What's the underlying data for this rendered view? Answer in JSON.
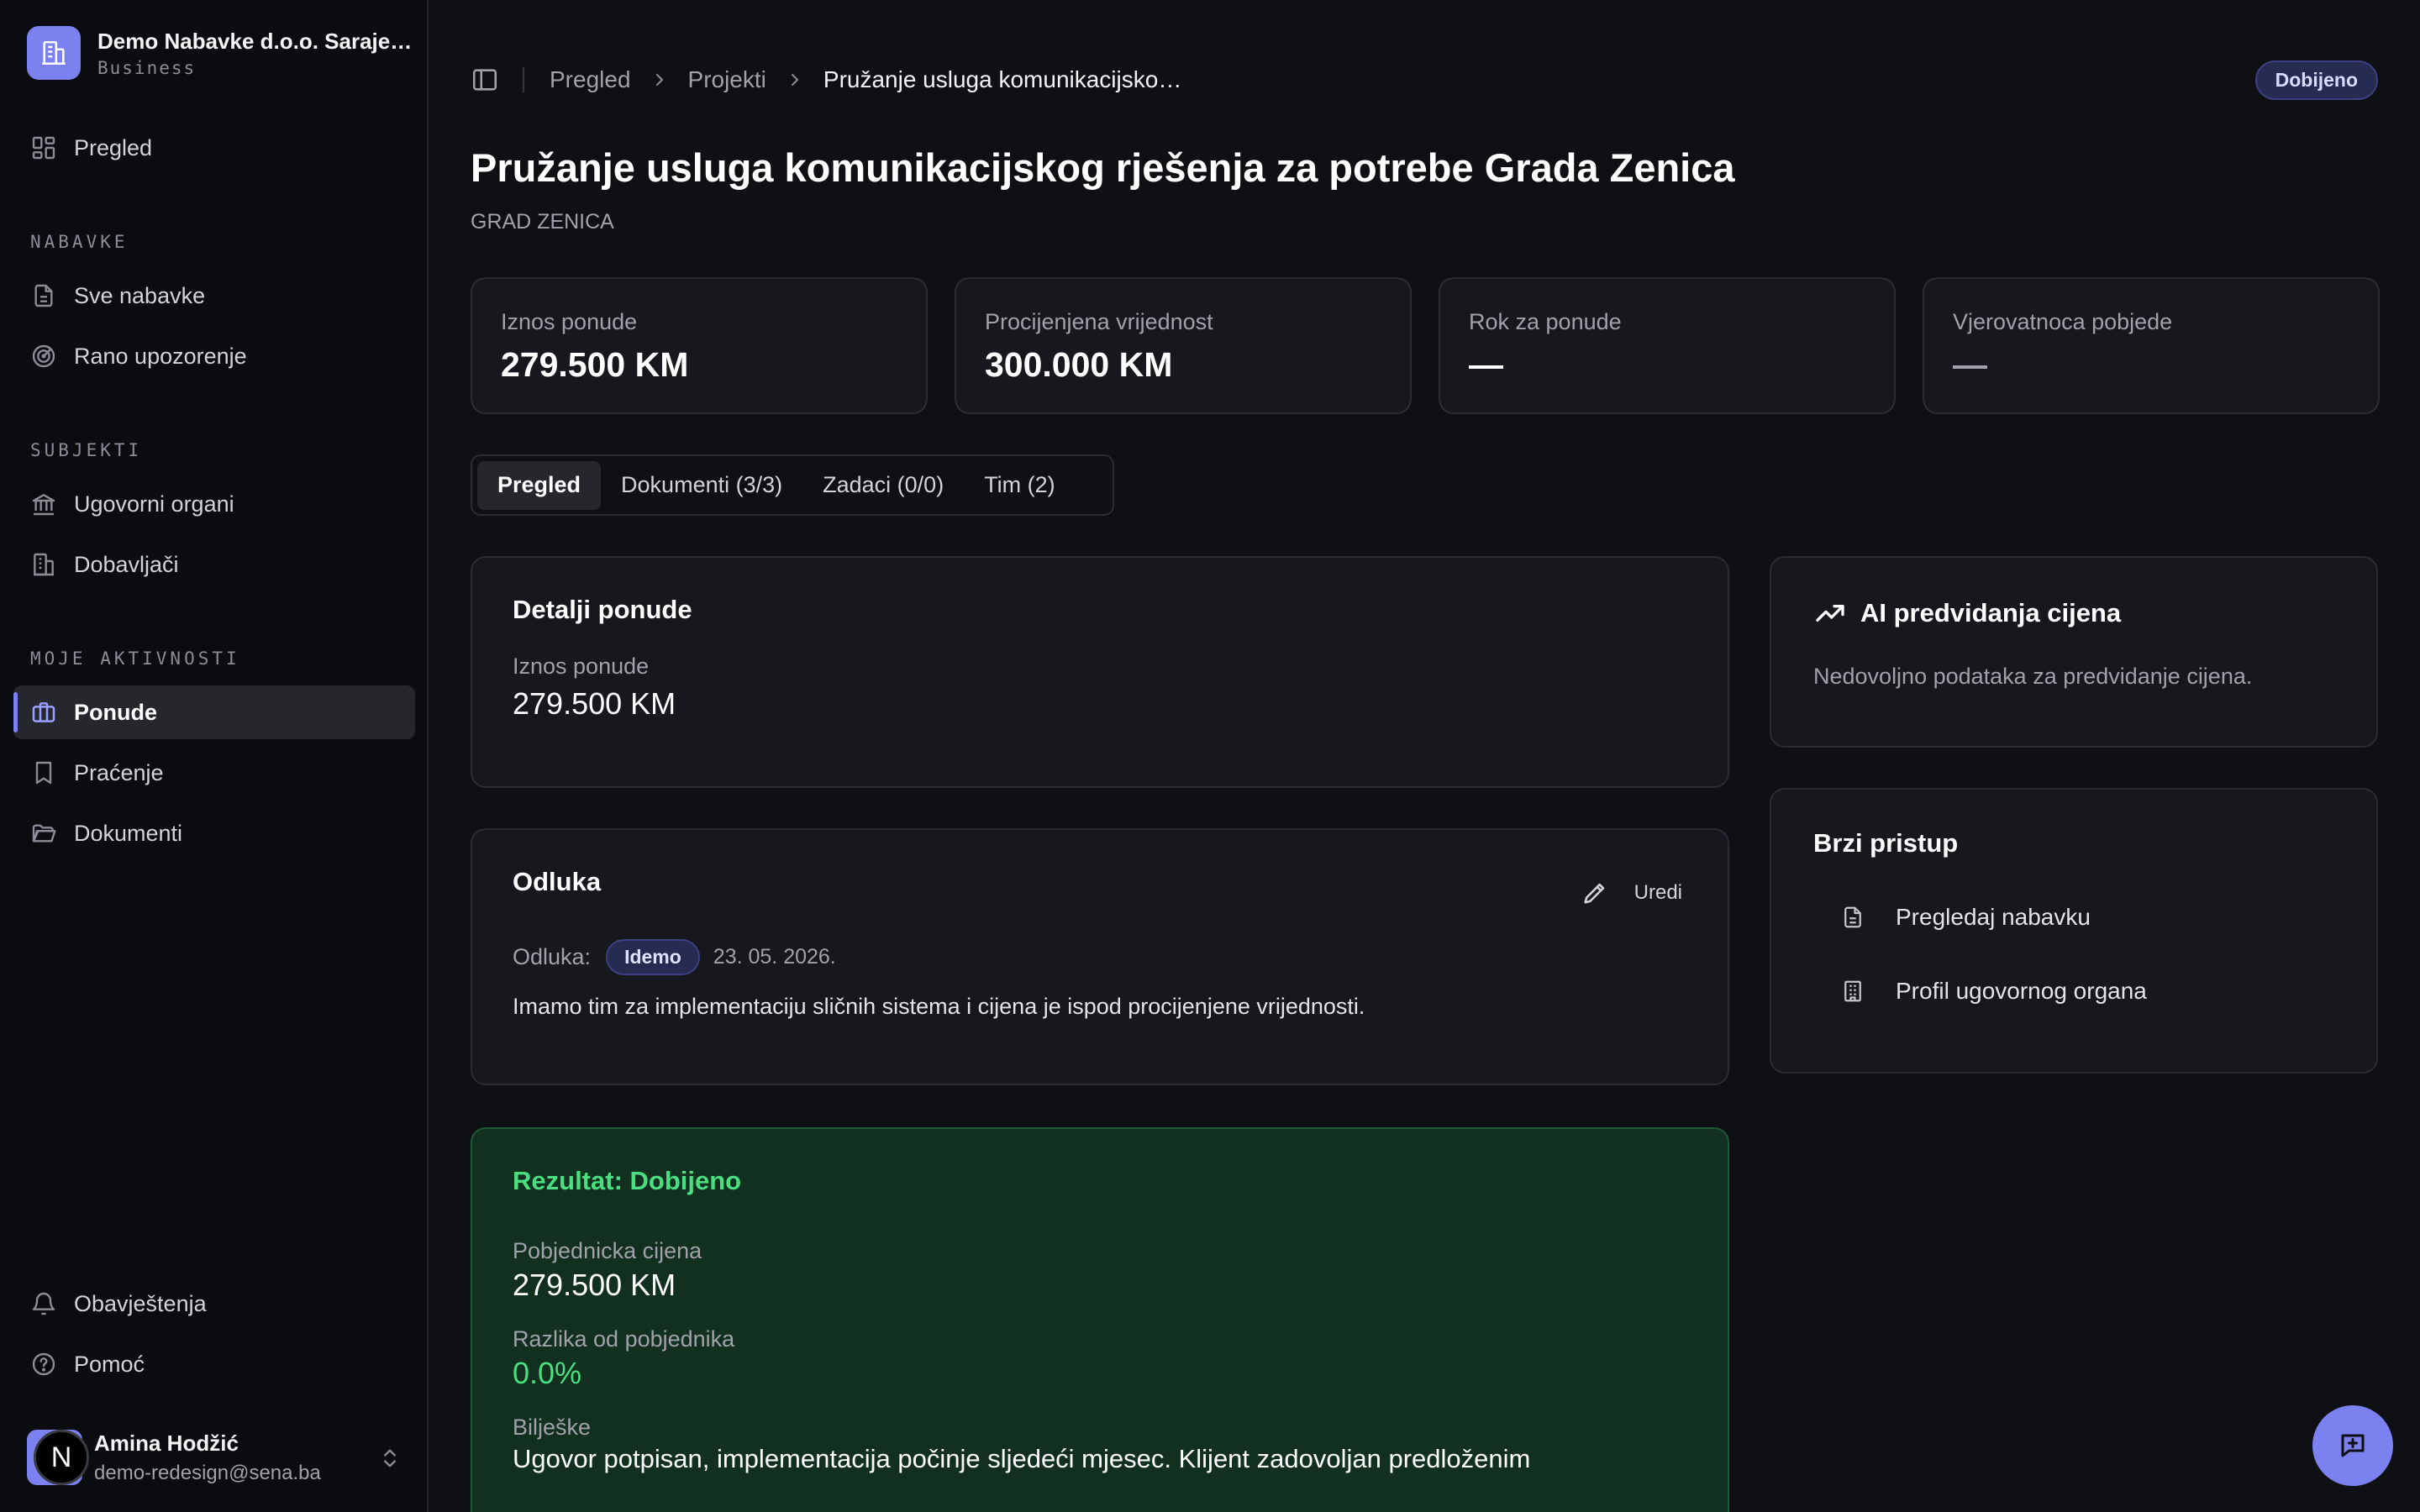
{
  "org": {
    "name": "Demo Nabavke d.o.o. Saraje…",
    "plan": "Business"
  },
  "sidebar": {
    "overview": "Pregled",
    "sections": {
      "nabavke": "NABAVKE",
      "subjekti": "SUBJEKTI",
      "aktivnosti": "MOJE AKTIVNOSTI"
    },
    "items": {
      "sve_nabavke": "Sve nabavke",
      "rano_upozorenje": "Rano upozorenje",
      "ugovorni_organi": "Ugovorni organi",
      "dobavljaci": "Dobavljači",
      "ponude": "Ponude",
      "pracenje": "Praćenje",
      "dokumenti": "Dokumenti",
      "obavjestenja": "Obavještenja",
      "pomoc": "Pomoć"
    },
    "active": "ponude"
  },
  "user": {
    "initial": "N",
    "name": "Amina Hodžić",
    "email": "demo-redesign@sena.ba"
  },
  "breadcrumb": [
    "Pregled",
    "Projekti",
    "Pružanje usluga komunikacijsko…"
  ],
  "status": "Dobijeno",
  "page": {
    "title": "Pružanje usluga komunikacijskog rješenja za potrebe Grada Zenica",
    "subtitle": "GRAD ZENICA"
  },
  "stats": [
    {
      "label": "Iznos ponude",
      "value": "279.500 KM"
    },
    {
      "label": "Procijenjena vrijednost",
      "value": "300.000 KM"
    },
    {
      "label": "Rok za ponude",
      "value": "—"
    },
    {
      "label": "Vjerovatnoca pobjede",
      "value": "—"
    }
  ],
  "tabs": [
    "Pregled",
    "Dokumenti (3/3)",
    "Zadaci (0/0)",
    "Tim (2)"
  ],
  "details": {
    "title": "Detalji ponude",
    "amount_label": "Iznos ponude",
    "amount_value": "279.500 KM"
  },
  "decision": {
    "title": "Odluka",
    "edit_label": "Uredi",
    "label": "Odluka:",
    "badge": "Idemo",
    "date": "23. 05. 2026.",
    "text": "Imamo tim za implementaciju sličnih sistema i cijena je ispod procijenjene vrijednosti."
  },
  "result": {
    "title": "Rezultat: Dobijeno",
    "winning_price_label": "Pobjednicka cijena",
    "winning_price_value": "279.500 KM",
    "diff_label": "Razlika od pobjednika",
    "diff_value": "0.0%",
    "notes_label": "Bilješke",
    "notes_value": "Ugovor potpisan, implementacija počinje sljedeći mjesec. Klijent zadovoljan predloženim"
  },
  "ai": {
    "title": "AI predvidanja cijena",
    "text": "Nedovoljno podataka za predvidanje cijena."
  },
  "quick": {
    "title": "Brzi pristup",
    "items": [
      "Pregledaj nabavku",
      "Profil ugovornog organa"
    ]
  },
  "colors": {
    "accent": "#7b82f0",
    "success": "#4ade80",
    "background": "#0f1014",
    "card": "#17181d"
  },
  "icons": {
    "org": "building-icon",
    "fab": "message-plus-icon"
  }
}
